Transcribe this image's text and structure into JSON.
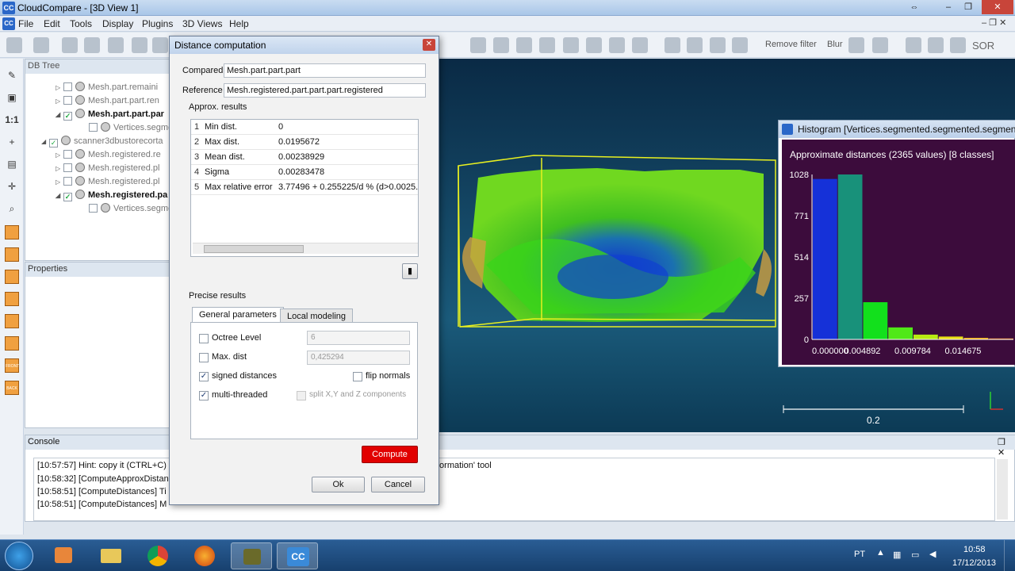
{
  "window": {
    "title": "CloudCompare - [3D View 1]",
    "app_icon": "CC"
  },
  "menu": [
    "File",
    "Edit",
    "Tools",
    "Display",
    "Plugins",
    "3D Views",
    "Help"
  ],
  "toolbar": {
    "remove_filter": "Remove filter",
    "blur": "Blur",
    "sor": "SOR"
  },
  "left_tools": {
    "zoom_label": "1:1",
    "front": "FRONT",
    "back": "BACK"
  },
  "db_tree": {
    "header": "DB Tree",
    "items": [
      {
        "label": "Mesh.part.remaini",
        "expanded": false,
        "checked": false,
        "bold": false
      },
      {
        "label": "Mesh.part.part.ren",
        "expanded": false,
        "checked": false,
        "bold": false
      },
      {
        "label": "Mesh.part.part.par",
        "expanded": true,
        "checked": true,
        "bold": true
      },
      {
        "label": "Vertices.segme",
        "expanded": false,
        "checked": false,
        "bold": false
      },
      {
        "label": "scanner3dbustorecorta",
        "expanded": true,
        "checked": true,
        "bold": false
      },
      {
        "label": "Mesh.registered.re",
        "expanded": false,
        "checked": false,
        "bold": false
      },
      {
        "label": "Mesh.registered.pl",
        "expanded": false,
        "checked": false,
        "bold": false
      },
      {
        "label": "Mesh.registered.pl",
        "expanded": false,
        "checked": false,
        "bold": false
      },
      {
        "label": "Mesh.registered.pa",
        "expanded": true,
        "checked": true,
        "bold": true
      },
      {
        "label": "Vertices.segme",
        "expanded": false,
        "checked": false,
        "bold": false
      }
    ]
  },
  "properties": {
    "header": "Properties"
  },
  "dialog": {
    "title": "Distance computation",
    "compared_label": "Compared",
    "compared_value": "Mesh.part.part.part",
    "reference_label": "Reference",
    "reference_value": "Mesh.registered.part.part.part.registered",
    "approx_title": "Approx. results",
    "approx_rows": [
      {
        "n": "1",
        "name": "Min dist.",
        "value": "0"
      },
      {
        "n": "2",
        "name": "Max dist.",
        "value": "0.0195672"
      },
      {
        "n": "3",
        "name": "Mean dist.",
        "value": "0.00238929"
      },
      {
        "n": "4",
        "name": "Sigma",
        "value": "0.00283478"
      },
      {
        "n": "5",
        "name": "Max relative error",
        "value": "3.77496 + 0.255225/d % (d>0.0025..."
      }
    ],
    "precise_title": "Precise results",
    "tabs": [
      "General parameters",
      "Local modeling"
    ],
    "octree_label": "Octree Level",
    "octree_value": "6",
    "maxdist_label": "Max. dist",
    "maxdist_value": "0,425294",
    "signed_label": "signed distances",
    "flip_label": "flip normals",
    "multithread_label": "multi-threaded",
    "split_label": "split X,Y and Z components",
    "compute_label": "Compute",
    "ok_label": "Ok",
    "cancel_label": "Cancel"
  },
  "histogram": {
    "title": "Histogram [Vertices.segmented.segmented.segmented]",
    "subtitle": "Approximate distances (2365 values) [8 classes]",
    "yticks": [
      "1028",
      "771",
      "514",
      "257",
      "0"
    ],
    "xticks": [
      "0.000000",
      "0.004892",
      "0.009784",
      "0.014675"
    ],
    "bins": [
      {
        "value": 1000,
        "color": "#1531d8"
      },
      {
        "value": 1028,
        "color": "#18917a"
      },
      {
        "value": 232,
        "color": "#12e01c"
      },
      {
        "value": 75,
        "color": "#50e818"
      },
      {
        "value": 30,
        "color": "#b8ea12"
      },
      {
        "value": 18,
        "color": "#e8e014"
      },
      {
        "value": 10,
        "color": "#f0b010"
      },
      {
        "value": 6,
        "color": "#f08010"
      }
    ]
  },
  "scale_bar": {
    "label": "0.2"
  },
  "console": {
    "header": "Console",
    "lines": [
      "[10:57:57] Hint: copy it (CTRL+C)",
      "[10:58:32] [ComputeApproxDistan",
      "[10:58:51] [ComputeDistances] Ti",
      "[10:58:51] [ComputeDistances] M"
    ],
    "line_tail": "formation' tool"
  },
  "taskbar": {
    "language": "PT",
    "time": "10:58",
    "date": "17/12/2013"
  }
}
